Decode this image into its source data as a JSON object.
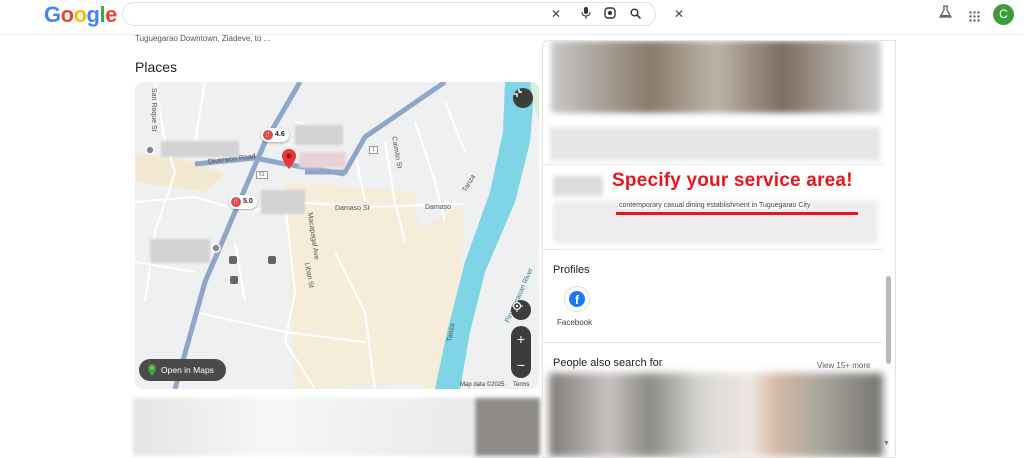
{
  "header": {
    "logo_letters": [
      {
        "ch": "G",
        "color": "#4285f4"
      },
      {
        "ch": "o",
        "color": "#ea4335"
      },
      {
        "ch": "o",
        "color": "#fbbc05"
      },
      {
        "ch": "g",
        "color": "#4285f4"
      },
      {
        "ch": "l",
        "color": "#34a853"
      },
      {
        "ch": "e",
        "color": "#ea4335"
      }
    ],
    "search_value": "",
    "icons": {
      "clear": "close-icon",
      "voice": "mic-icon",
      "lens": "camera-lens-icon",
      "search": "search-icon",
      "labs": "labs-flask-icon",
      "apps": "apps-grid-icon"
    },
    "avatar_letter": "C",
    "avatar_color": "#3f9b3a"
  },
  "result_snippet": "Tuguegarao Downtown, Ziadeve, to ...",
  "places": {
    "title": "Places",
    "map": {
      "labels": {
        "san_roque": "San Roque St",
        "diversion": "Diversion Road",
        "caimito": "Caimito St",
        "damaso1": "Damaso St",
        "damaso2": "Damaso",
        "macapagal": "Macapagal Ave",
        "liban": "Liban St",
        "tanza1": "Tanza",
        "tanza2": "Tanza",
        "river": "Pinacanauan River",
        "route51": "51",
        "route1": "1"
      },
      "ratings": [
        "4.6",
        "5.0"
      ],
      "open_maps": "Open in Maps",
      "attribution": "Map data ©2025",
      "terms": "Terms"
    }
  },
  "knowledge_panel": {
    "overlay_title": "Specify your service area!",
    "description": "contemporary casual dining establishment in Tuguegarao City",
    "profiles_title": "Profiles",
    "facebook_label": "Facebook",
    "people_also_search": "People also search for",
    "view_more": "View 15+ more"
  }
}
